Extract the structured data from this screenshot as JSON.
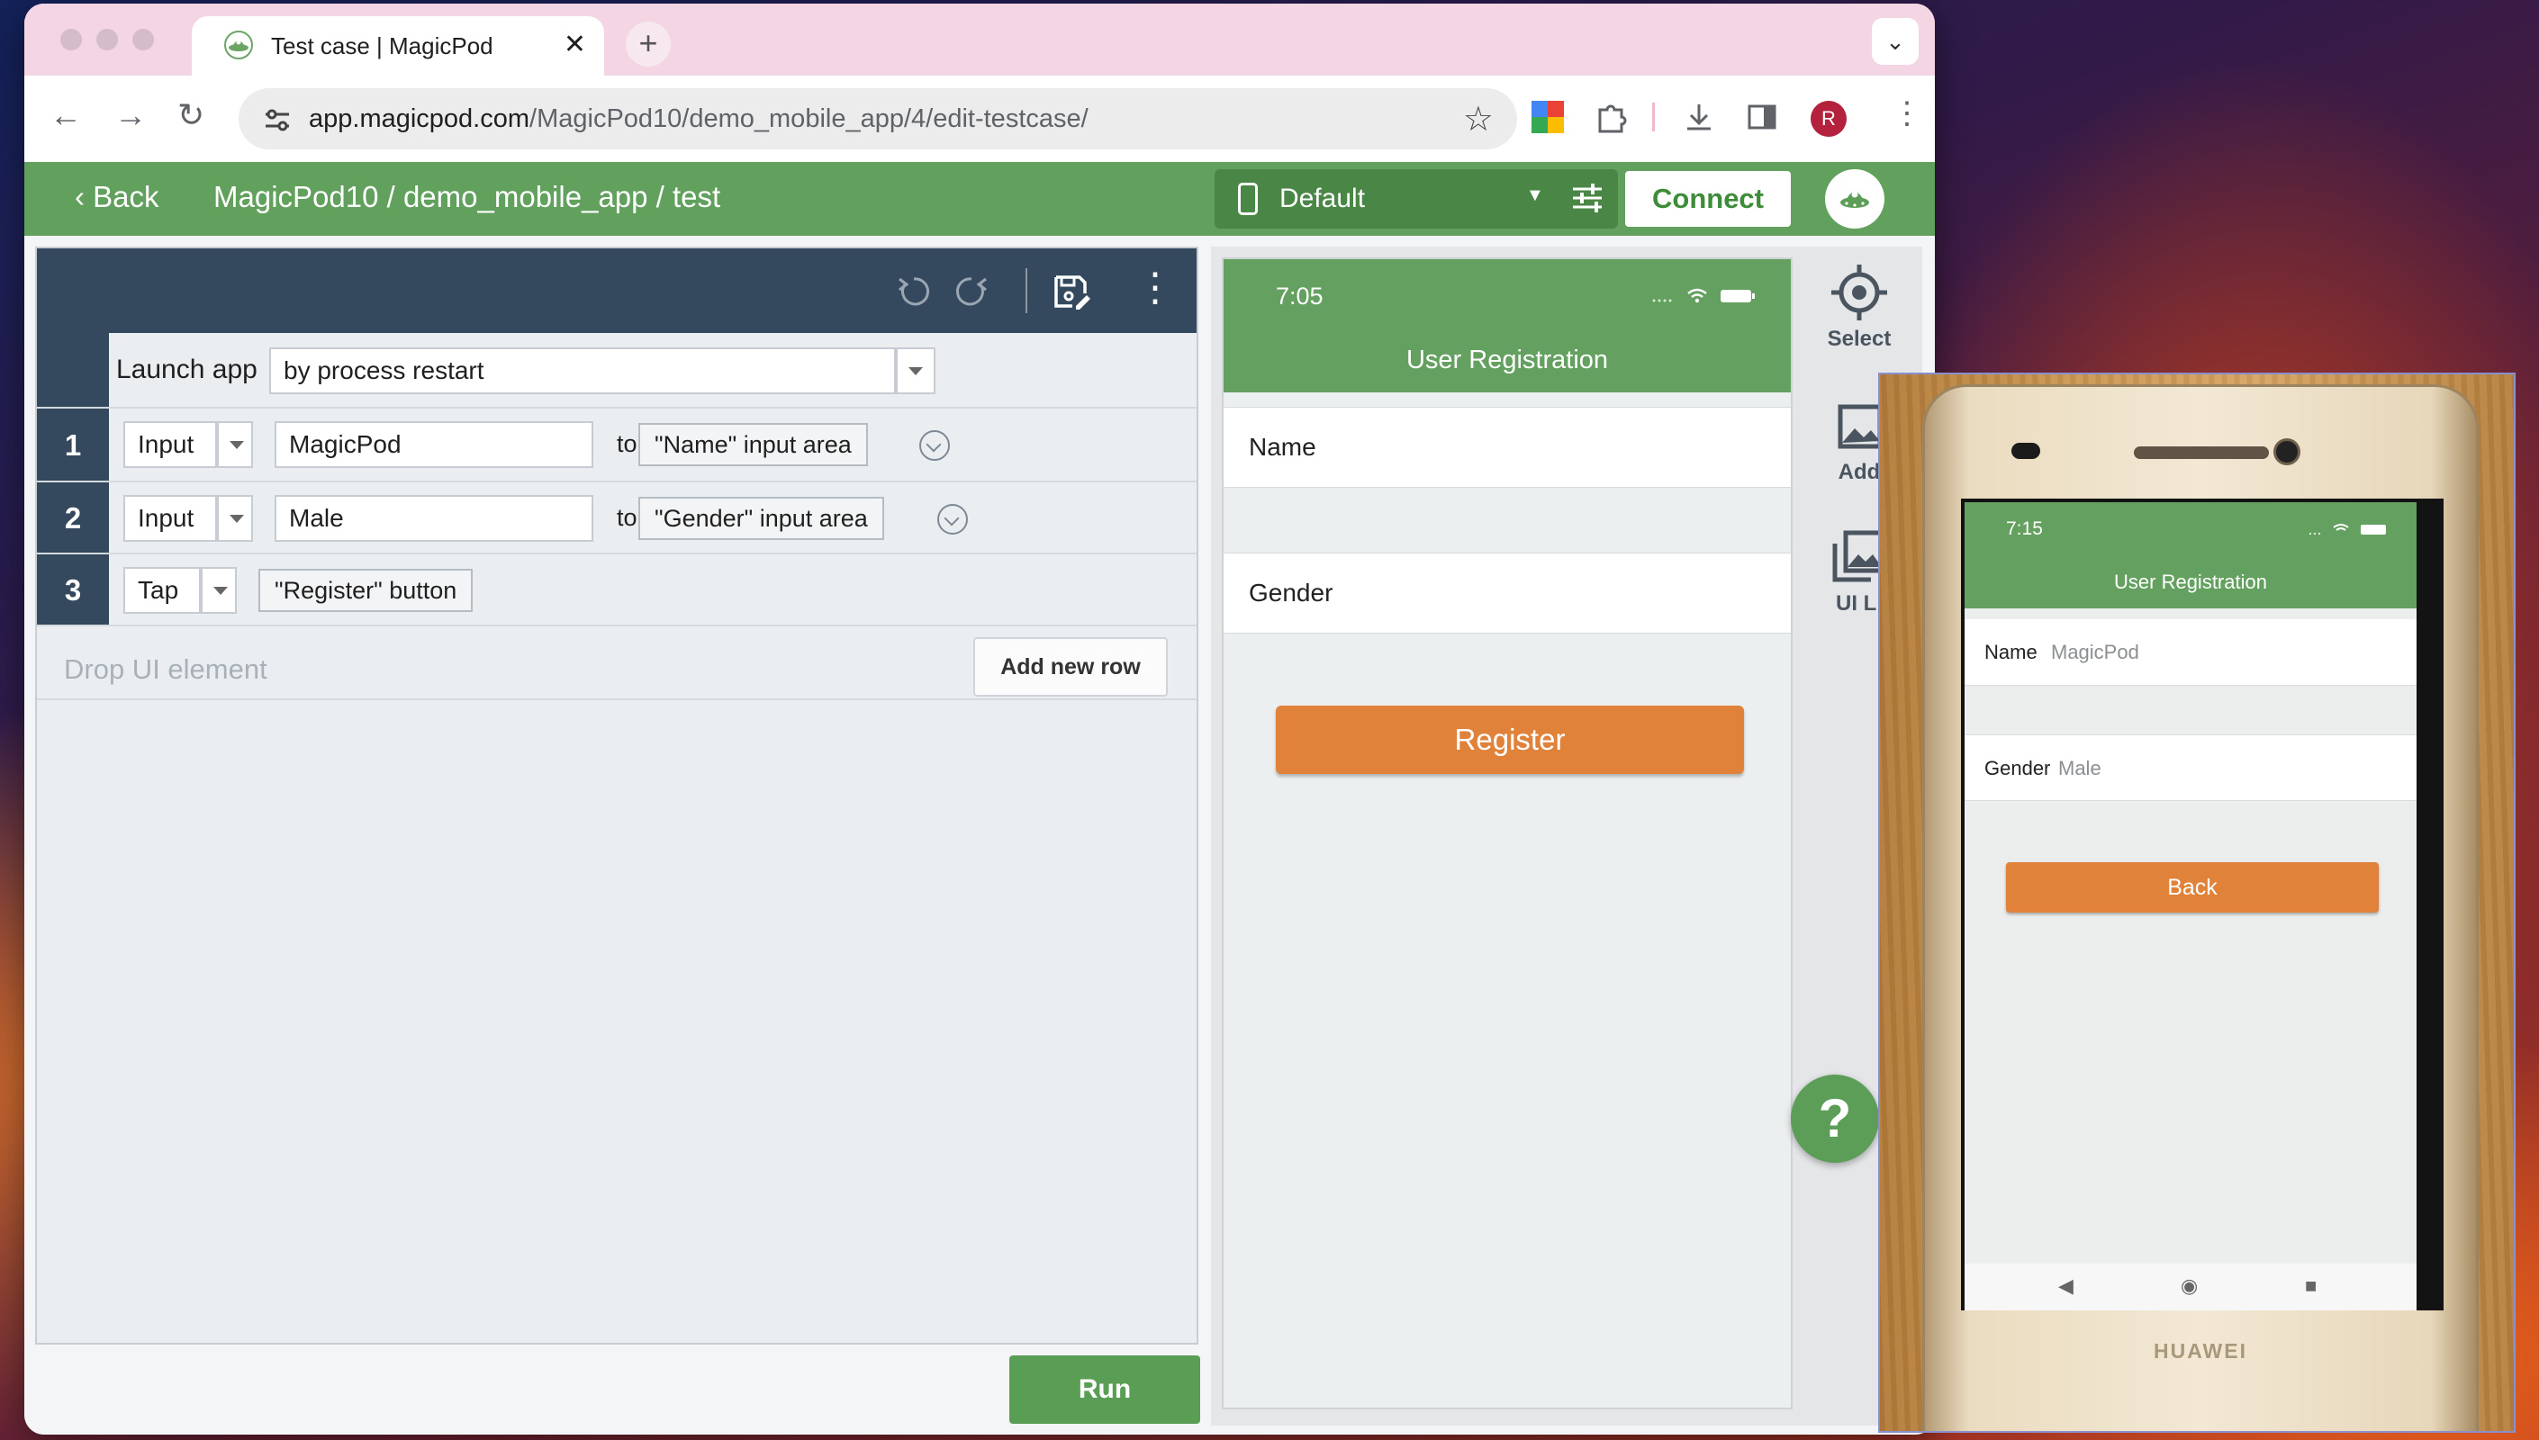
{
  "browser": {
    "tab_title": "Test case | MagicPod",
    "new_tab_label": "+",
    "url_domain": "app.magicpod.com",
    "url_path": "/MagicPod10/demo_mobile_app/4/edit-testcase/",
    "profile_initial": "R"
  },
  "header": {
    "back_label": "Back",
    "breadcrumb": "MagicPod10 / demo_mobile_app / test",
    "device_label": "Default",
    "connect_label": "Connect"
  },
  "editor": {
    "launch": {
      "label": "Launch app",
      "value": "by process restart"
    },
    "steps": [
      {
        "num": "1",
        "action": "Input",
        "value": "MagicPod",
        "connector": "to",
        "target": "\"Name\" input area"
      },
      {
        "num": "2",
        "action": "Input",
        "value": "Male",
        "connector": "to",
        "target": "\"Gender\" input area"
      },
      {
        "num": "3",
        "action": "Tap",
        "target": "\"Register\" button"
      }
    ],
    "drop_placeholder": "Drop UI element",
    "add_row_label": "Add new row",
    "run_label": "Run"
  },
  "preview": {
    "time": "7:05",
    "title": "User Registration",
    "field_name": "Name",
    "field_gender": "Gender",
    "button_label": "Register"
  },
  "tools": {
    "select_label": "Select",
    "add_label": "Add",
    "ui_list_label": "UI Li"
  },
  "help_label": "?",
  "phone": {
    "time": "7:15",
    "title": "User Registration",
    "name_label": "Name",
    "name_value": "MagicPod",
    "gender_label": "Gender",
    "gender_value": "Male",
    "button_label": "Back",
    "brand": "HUAWEI",
    "nav_back": "◀",
    "nav_home": "◉",
    "nav_recent": "■"
  },
  "colors": {
    "brand_green": "#62a05e",
    "toolbar_navy": "#34495e",
    "accent_orange": "#e0823a"
  }
}
